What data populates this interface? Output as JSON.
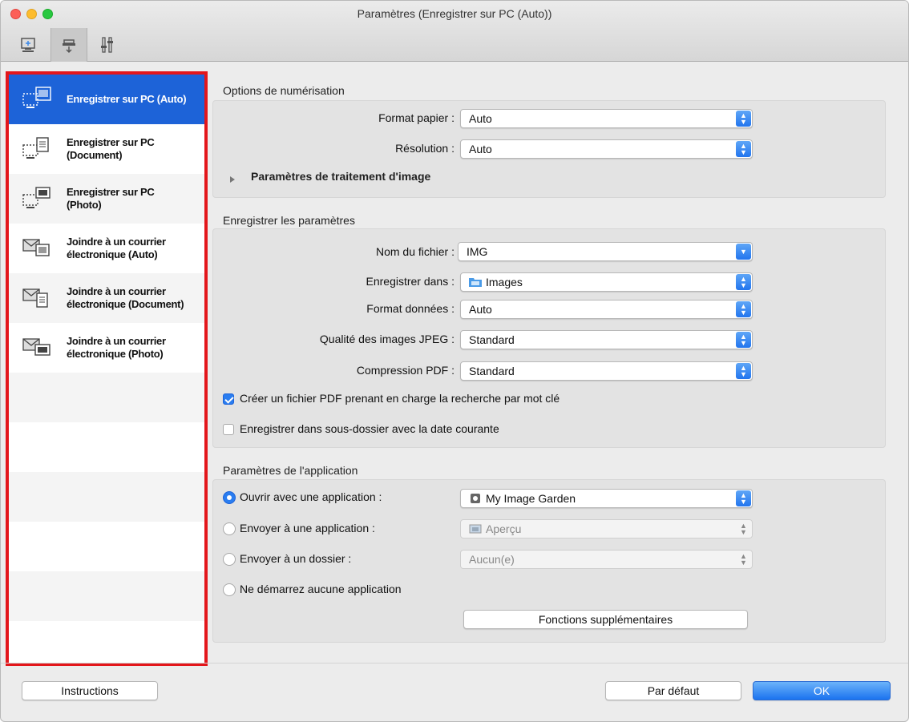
{
  "window": {
    "title": "Paramètres (Enregistrer sur PC (Auto))",
    "accent_color": "#1d63d8",
    "highlight_color": "#e3161b"
  },
  "toolbar": {
    "tabs": [
      {
        "icon": "scan-from-computer-icon"
      },
      {
        "icon": "scan-from-operation-panel-icon"
      },
      {
        "icon": "general-settings-icon"
      }
    ]
  },
  "sidebar": {
    "items": [
      {
        "line1": "Enregistrer sur PC (Auto)",
        "line2": "",
        "icon": "save-to-pc-auto-icon"
      },
      {
        "line1": "Enregistrer sur PC",
        "line2": "(Document)",
        "icon": "save-to-pc-document-icon"
      },
      {
        "line1": "Enregistrer sur PC",
        "line2": "(Photo)",
        "icon": "save-to-pc-photo-icon"
      },
      {
        "line1": "Joindre à un courrier",
        "line2": "électronique (Auto)",
        "icon": "attach-email-auto-icon"
      },
      {
        "line1": "Joindre à un courrier",
        "line2": "électronique (Document)",
        "icon": "attach-email-document-icon"
      },
      {
        "line1": "Joindre à un courrier",
        "line2": "électronique (Photo)",
        "icon": "attach-email-photo-icon"
      }
    ]
  },
  "scan_options": {
    "title": "Options de numérisation",
    "paper_size_label": "Format papier :",
    "paper_size_value": "Auto",
    "resolution_label": "Résolution :",
    "resolution_value": "Auto",
    "image_processing_label": "Paramètres de traitement d'image"
  },
  "save_settings": {
    "title": "Enregistrer les paramètres",
    "file_name_label": "Nom du fichier :",
    "file_name_value": "IMG",
    "save_in_label": "Enregistrer dans :",
    "save_in_value": "Images",
    "data_format_label": "Format données :",
    "data_format_value": "Auto",
    "jpeg_quality_label": "Qualité des images JPEG :",
    "jpeg_quality_value": "Standard",
    "pdf_compression_label": "Compression PDF :",
    "pdf_compression_value": "Standard",
    "keyword_pdf_label": "Créer un fichier PDF prenant en charge la recherche par mot clé",
    "keyword_pdf_checked": true,
    "subfolder_label": "Enregistrer dans sous-dossier avec la date courante",
    "subfolder_checked": false
  },
  "app_settings": {
    "title": "Paramètres de l'application",
    "open_with_label": "Ouvrir avec une application :",
    "open_with_value": "My Image Garden",
    "send_to_app_label": "Envoyer à une application :",
    "send_to_app_value": "Aperçu",
    "send_to_folder_label": "Envoyer à un dossier :",
    "send_to_folder_value": "Aucun(e)",
    "no_app_label": "Ne démarrez aucune application",
    "selected_option": "open_with",
    "more_functions_label": "Fonctions supplémentaires"
  },
  "footer": {
    "instructions_label": "Instructions",
    "defaults_label": "Par défaut",
    "ok_label": "OK"
  }
}
